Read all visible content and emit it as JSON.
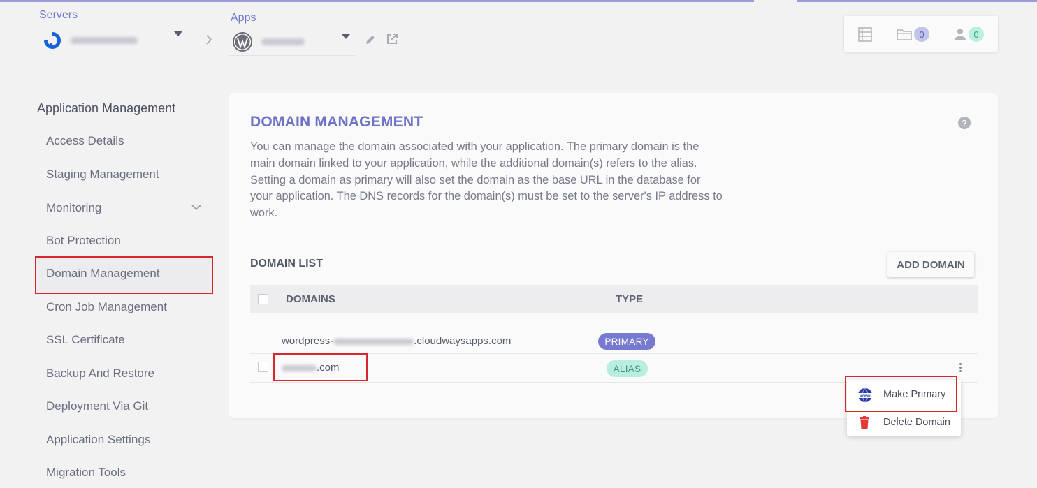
{
  "header": {
    "servers_label": "Servers",
    "apps_label": "Apps",
    "notification_count": "0",
    "team_count": "0"
  },
  "sidebar": {
    "title": "Application Management",
    "items": [
      {
        "label": "Access Details"
      },
      {
        "label": "Staging Management"
      },
      {
        "label": "Monitoring"
      },
      {
        "label": "Bot Protection"
      },
      {
        "label": "Domain Management"
      },
      {
        "label": "Cron Job Management"
      },
      {
        "label": "SSL Certificate"
      },
      {
        "label": "Backup And Restore"
      },
      {
        "label": "Deployment Via Git"
      },
      {
        "label": "Application Settings"
      },
      {
        "label": "Migration Tools"
      }
    ],
    "active_item": "Domain Management"
  },
  "main": {
    "title": "DOMAIN MANAGEMENT",
    "description": "You can manage the domain associated with your application. The primary domain is the main domain linked to your application, while the additional domain(s) refers to the alias. Setting a domain as primary will also set the domain as the base URL in the database for your application. The DNS records for the domain(s) must be set to the server's IP address to work.",
    "help": "?",
    "list_title": "DOMAIN LIST",
    "add_button": "ADD DOMAIN",
    "columns": [
      "DOMAINS",
      "TYPE"
    ],
    "rows": [
      {
        "domain_prefix": "wordpress-",
        "domain_suffix": ".cloudwaysapps.com",
        "type": "PRIMARY"
      },
      {
        "domain_suffix": ".com",
        "type": "ALIAS"
      }
    ]
  },
  "menu": {
    "items": [
      {
        "label": "Make Primary",
        "icon": "www-globe-icon"
      },
      {
        "label": "Delete Domain",
        "icon": "trash-icon"
      }
    ]
  },
  "colors": {
    "accent": "#6d72c6",
    "primary_pill": "#7679d0",
    "alias_pill": "#b8eedf",
    "highlight": "#d9262c",
    "delete": "#e53935"
  }
}
